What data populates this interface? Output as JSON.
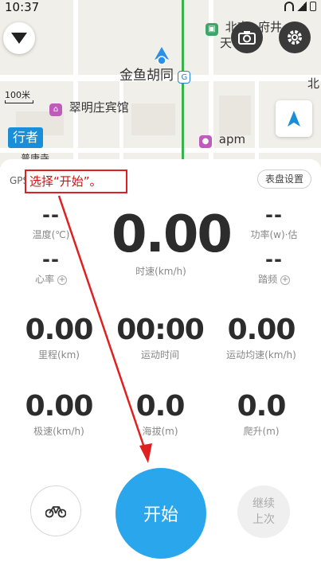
{
  "status": {
    "time": "10:37"
  },
  "map": {
    "labels": {
      "place_main": "金鱼胡同",
      "hotel": "翠明庄宾馆",
      "apm": "apm",
      "north1": "北京",
      "north2": "府井",
      "north3": "天",
      "right_edge": "北",
      "bottom_left": "普康寺"
    },
    "scale": "100米",
    "logo": "行者"
  },
  "panel": {
    "gps": "GPS",
    "annotation": "选择“开始”。",
    "dial_settings": "表盘设置",
    "left_top": {
      "value": "--",
      "label": "温度(℃)"
    },
    "left_bottom": {
      "value": "--",
      "label": "心率"
    },
    "speed": {
      "value": "0.00",
      "label": "时速(km/h)"
    },
    "right_top": {
      "value": "--",
      "label": "功率(w)·估"
    },
    "right_bottom": {
      "value": "--",
      "label": "踏频"
    },
    "grid": [
      {
        "value": "0.00",
        "label": "里程(km)"
      },
      {
        "value": "00:00",
        "label": "运动时间"
      },
      {
        "value": "0.00",
        "label": "运动均速(km/h)"
      },
      {
        "value": "0.00",
        "label": "极速(km/h)"
      },
      {
        "value": "0.0",
        "label": "海拔(m)"
      },
      {
        "value": "0.0",
        "label": "爬升(m)"
      }
    ],
    "start": "开始",
    "resume_line1": "继续",
    "resume_line2": "上次"
  },
  "colors": {
    "accent": "#2aa7ec",
    "annotation": "#e02020",
    "route": "#37b24d"
  }
}
